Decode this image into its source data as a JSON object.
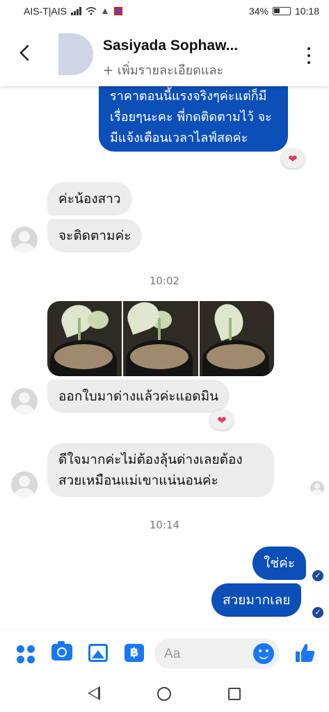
{
  "status_bar": {
    "carrier": "AIS-T|AIS",
    "battery_percent": "34%",
    "time": "10:18"
  },
  "header": {
    "contact_name": "Sasiyada Sophaw...",
    "subtitle": "+ เพิ่มรายละเอียดและ",
    "icons": {
      "back": "back-arrow-icon",
      "more": "more-options-icon"
    }
  },
  "messages": {
    "out_1": {
      "lines": [
        "ราคาตอนนี้แรงจริงๆค่ะแต่ก็มี",
        "เรื่อยๆนะคะ พี่กดติดตามไว้ จะ",
        "มีแจ้งเตือนเวลาไลฟ์สดค่ะ"
      ],
      "reaction": "❤"
    },
    "in_1": "ค่ะน้องสาว",
    "in_2": "จะติดตามค่ะ",
    "time_1": "10:02",
    "photos_count": 3,
    "in_3": {
      "text": "ออกใบมาด่างแล้วค่ะแอดมิน",
      "reaction": "❤"
    },
    "in_4": {
      "lines": [
        "ดีใจมากค่ะไม่ต้องลุ้นด่างเลยต้อง",
        "สวยเหมือนแม่เขาแน่นอนค่ะ"
      ]
    },
    "time_2": "10:14",
    "out_2": "ใช่ค่ะ",
    "out_3": "สวยมากเลย",
    "seen_check": "✓"
  },
  "composer": {
    "placeholder": "Aa",
    "pay_symbol": "฿",
    "icons": [
      "apps-icon",
      "camera-icon",
      "gallery-icon",
      "payment-icon",
      "emoji-icon",
      "like-icon"
    ]
  },
  "colors": {
    "outgoing_bubble": "#0c4fb8",
    "incoming_bubble": "#ececec",
    "accent": "#1877f2",
    "reaction_heart": "#e83a62"
  }
}
